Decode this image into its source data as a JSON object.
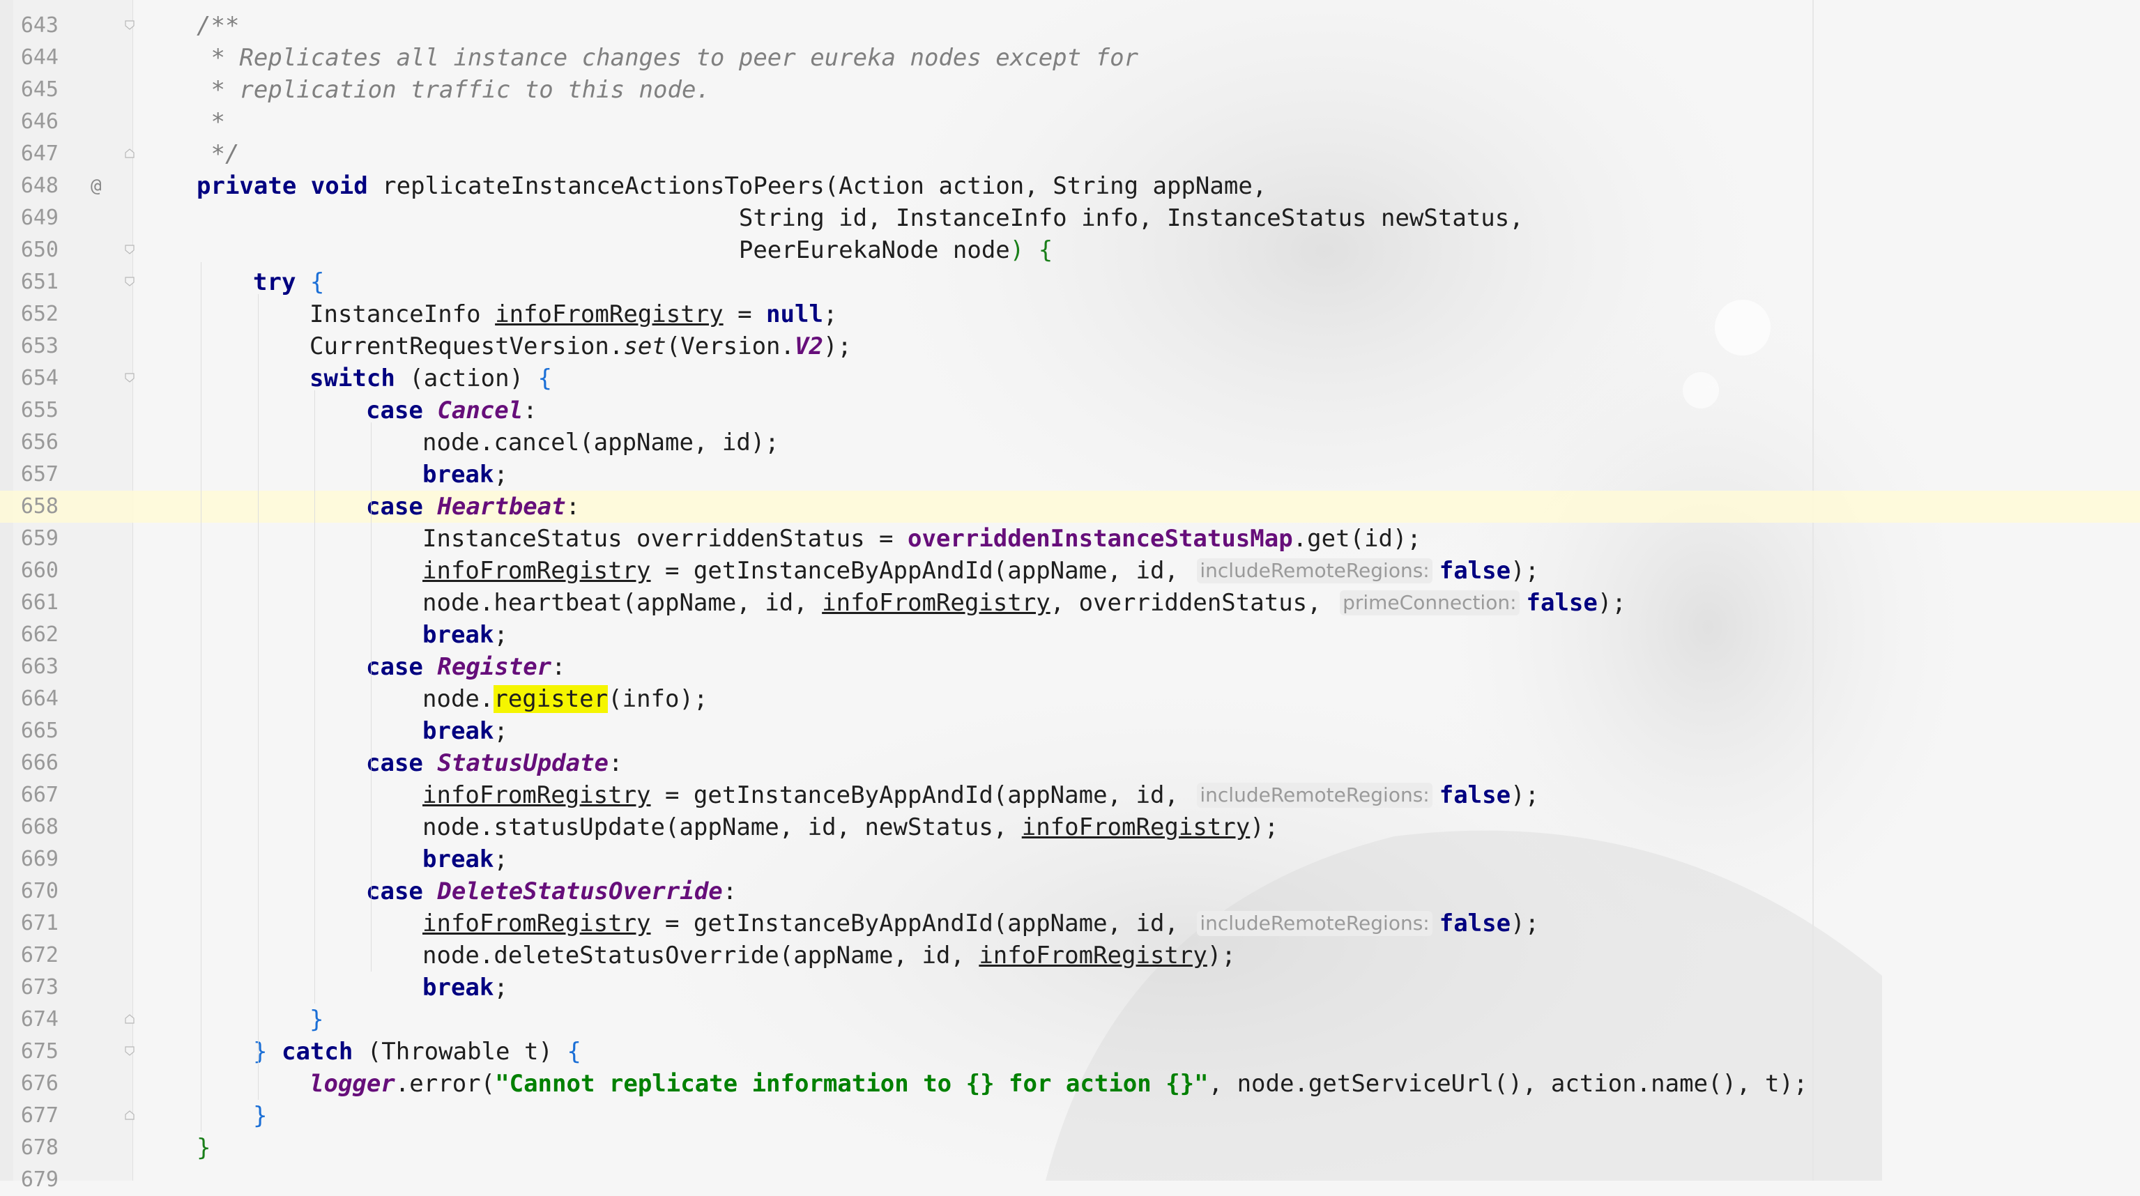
{
  "editor": {
    "lines": [
      {
        "num": "643",
        "gutter_icon": "",
        "fold": "start",
        "indent": 0,
        "tokens": [
          [
            "cm",
            "/**"
          ]
        ]
      },
      {
        "num": "644",
        "gutter_icon": "",
        "fold": "",
        "indent": 0,
        "tokens": [
          [
            "cm",
            " * Replicates all instance changes to peer eureka nodes except for"
          ]
        ]
      },
      {
        "num": "645",
        "gutter_icon": "",
        "fold": "",
        "indent": 0,
        "tokens": [
          [
            "cm",
            " * replication traffic to this node."
          ]
        ]
      },
      {
        "num": "646",
        "gutter_icon": "",
        "fold": "",
        "indent": 0,
        "tokens": [
          [
            "cm",
            " *"
          ]
        ]
      },
      {
        "num": "647",
        "gutter_icon": "",
        "fold": "end",
        "indent": 0,
        "tokens": [
          [
            "cm",
            " */"
          ]
        ]
      },
      {
        "num": "648",
        "gutter_icon": "@",
        "fold": "",
        "indent": 0,
        "tokens": [
          [
            "kw",
            "private"
          ],
          [
            "t",
            " "
          ],
          [
            "kw",
            "void"
          ],
          [
            "t",
            " replicateInstanceActionsToPeers(Action action, String appName,"
          ]
        ]
      },
      {
        "num": "649",
        "gutter_icon": "",
        "fold": "",
        "indent": 0,
        "tokens": [
          [
            "t",
            "                                      String id, InstanceInfo info, InstanceStatus newStatus,"
          ]
        ]
      },
      {
        "num": "650",
        "gutter_icon": "",
        "fold": "start",
        "indent": 0,
        "tokens": [
          [
            "t",
            "                                      PeerEurekaNode node"
          ],
          [
            "brg",
            ")"
          ],
          [
            "t",
            " "
          ],
          [
            "brg",
            "{"
          ]
        ]
      },
      {
        "num": "651",
        "gutter_icon": "",
        "fold": "start",
        "indent": 1,
        "tokens": [
          [
            "kw",
            "try"
          ],
          [
            "t",
            " "
          ],
          [
            "br",
            "{"
          ]
        ]
      },
      {
        "num": "652",
        "gutter_icon": "",
        "fold": "",
        "indent": 2,
        "tokens": [
          [
            "t",
            "InstanceInfo "
          ],
          [
            "ul",
            "infoFromRegistry"
          ],
          [
            "t",
            " = "
          ],
          [
            "kw",
            "null"
          ],
          [
            "t",
            ";"
          ]
        ]
      },
      {
        "num": "653",
        "gutter_icon": "",
        "fold": "",
        "indent": 2,
        "tokens": [
          [
            "t",
            "CurrentRequestVersion."
          ],
          [
            "st",
            "set"
          ],
          [
            "t",
            "(Version."
          ],
          [
            "en",
            "V2"
          ],
          [
            "t",
            ");"
          ]
        ]
      },
      {
        "num": "654",
        "gutter_icon": "",
        "fold": "start",
        "indent": 2,
        "tokens": [
          [
            "kw",
            "switch"
          ],
          [
            "t",
            " (action) "
          ],
          [
            "br",
            "{"
          ]
        ]
      },
      {
        "num": "655",
        "gutter_icon": "",
        "fold": "",
        "indent": 3,
        "tokens": [
          [
            "kw",
            "case"
          ],
          [
            "t",
            " "
          ],
          [
            "en",
            "Cancel"
          ],
          [
            "t",
            ":"
          ]
        ]
      },
      {
        "num": "656",
        "gutter_icon": "",
        "fold": "",
        "indent": 4,
        "tokens": [
          [
            "t",
            "node.cancel(appName, id);"
          ]
        ]
      },
      {
        "num": "657",
        "gutter_icon": "",
        "fold": "",
        "indent": 4,
        "tokens": [
          [
            "kw",
            "break"
          ],
          [
            "t",
            ";"
          ]
        ]
      },
      {
        "num": "658",
        "gutter_icon": "",
        "fold": "",
        "indent": 3,
        "highlight": true,
        "tokens": [
          [
            "kw",
            "case"
          ],
          [
            "t",
            " "
          ],
          [
            "en",
            "Heartbeat"
          ],
          [
            "t",
            ":"
          ]
        ]
      },
      {
        "num": "659",
        "gutter_icon": "",
        "fold": "",
        "indent": 4,
        "tokens": [
          [
            "t",
            "InstanceStatus overriddenStatus = "
          ],
          [
            "fld",
            "overriddenInstanceStatusMap"
          ],
          [
            "t",
            ".get(id);"
          ]
        ]
      },
      {
        "num": "660",
        "gutter_icon": "",
        "fold": "",
        "indent": 4,
        "tokens": [
          [
            "ul",
            "infoFromRegistry"
          ],
          [
            "t",
            " = getInstanceByAppAndId(appName, id, "
          ],
          [
            "hint",
            "includeRemoteRegions:"
          ],
          [
            "kw",
            "false"
          ],
          [
            "t",
            ");"
          ]
        ]
      },
      {
        "num": "661",
        "gutter_icon": "",
        "fold": "",
        "indent": 4,
        "tokens": [
          [
            "t",
            "node.heartbeat(appName, id, "
          ],
          [
            "ul",
            "infoFromRegistry"
          ],
          [
            "t",
            ", overriddenStatus, "
          ],
          [
            "hint",
            "primeConnection:"
          ],
          [
            "kw",
            "false"
          ],
          [
            "t",
            ");"
          ]
        ]
      },
      {
        "num": "662",
        "gutter_icon": "",
        "fold": "",
        "indent": 4,
        "tokens": [
          [
            "kw",
            "break"
          ],
          [
            "t",
            ";"
          ]
        ]
      },
      {
        "num": "663",
        "gutter_icon": "",
        "fold": "",
        "indent": 3,
        "tokens": [
          [
            "kw",
            "case"
          ],
          [
            "t",
            " "
          ],
          [
            "en",
            "Register"
          ],
          [
            "t",
            ":"
          ]
        ]
      },
      {
        "num": "664",
        "gutter_icon": "",
        "fold": "",
        "indent": 4,
        "tokens": [
          [
            "t",
            "node."
          ],
          [
            "mark",
            "register"
          ],
          [
            "t",
            "(info);"
          ]
        ]
      },
      {
        "num": "665",
        "gutter_icon": "",
        "fold": "",
        "indent": 4,
        "tokens": [
          [
            "kw",
            "break"
          ],
          [
            "t",
            ";"
          ]
        ]
      },
      {
        "num": "666",
        "gutter_icon": "",
        "fold": "",
        "indent": 3,
        "tokens": [
          [
            "kw",
            "case"
          ],
          [
            "t",
            " "
          ],
          [
            "en",
            "StatusUpdate"
          ],
          [
            "t",
            ":"
          ]
        ]
      },
      {
        "num": "667",
        "gutter_icon": "",
        "fold": "",
        "indent": 4,
        "tokens": [
          [
            "ul",
            "infoFromRegistry"
          ],
          [
            "t",
            " = getInstanceByAppAndId(appName, id, "
          ],
          [
            "hint",
            "includeRemoteRegions:"
          ],
          [
            "kw",
            "false"
          ],
          [
            "t",
            ");"
          ]
        ]
      },
      {
        "num": "668",
        "gutter_icon": "",
        "fold": "",
        "indent": 4,
        "tokens": [
          [
            "t",
            "node.statusUpdate(appName, id, newStatus, "
          ],
          [
            "ul",
            "infoFromRegistry"
          ],
          [
            "t",
            ");"
          ]
        ]
      },
      {
        "num": "669",
        "gutter_icon": "",
        "fold": "",
        "indent": 4,
        "tokens": [
          [
            "kw",
            "break"
          ],
          [
            "t",
            ";"
          ]
        ]
      },
      {
        "num": "670",
        "gutter_icon": "",
        "fold": "",
        "indent": 3,
        "tokens": [
          [
            "kw",
            "case"
          ],
          [
            "t",
            " "
          ],
          [
            "en",
            "DeleteStatusOverride"
          ],
          [
            "t",
            ":"
          ]
        ]
      },
      {
        "num": "671",
        "gutter_icon": "",
        "fold": "",
        "indent": 4,
        "tokens": [
          [
            "ul",
            "infoFromRegistry"
          ],
          [
            "t",
            " = getInstanceByAppAndId(appName, id, "
          ],
          [
            "hint",
            "includeRemoteRegions:"
          ],
          [
            "kw",
            "false"
          ],
          [
            "t",
            ");"
          ]
        ]
      },
      {
        "num": "672",
        "gutter_icon": "",
        "fold": "",
        "indent": 4,
        "tokens": [
          [
            "t",
            "node.deleteStatusOverride(appName, id, "
          ],
          [
            "ul",
            "infoFromRegistry"
          ],
          [
            "t",
            ");"
          ]
        ]
      },
      {
        "num": "673",
        "gutter_icon": "",
        "fold": "",
        "indent": 4,
        "tokens": [
          [
            "kw",
            "break"
          ],
          [
            "t",
            ";"
          ]
        ]
      },
      {
        "num": "674",
        "gutter_icon": "",
        "fold": "end",
        "indent": 2,
        "tokens": [
          [
            "br",
            "}"
          ]
        ]
      },
      {
        "num": "675",
        "gutter_icon": "",
        "fold": "start",
        "indent": 1,
        "tokens": [
          [
            "br",
            "}"
          ],
          [
            "t",
            " "
          ],
          [
            "kw",
            "catch"
          ],
          [
            "t",
            " (Throwable t) "
          ],
          [
            "br",
            "{"
          ]
        ]
      },
      {
        "num": "676",
        "gutter_icon": "",
        "fold": "",
        "indent": 2,
        "tokens": [
          [
            "fldi",
            "logger"
          ],
          [
            "t",
            ".error("
          ],
          [
            "str",
            "\"Cannot replicate information to {} for action {}\""
          ],
          [
            "t",
            ", node.getServiceUrl(), action.name(), t);"
          ]
        ]
      },
      {
        "num": "677",
        "gutter_icon": "",
        "fold": "end",
        "indent": 1,
        "tokens": [
          [
            "br",
            "}"
          ]
        ]
      },
      {
        "num": "678",
        "gutter_icon": "",
        "fold": "",
        "indent": 0,
        "tokens": [
          [
            "brg",
            "}"
          ]
        ]
      },
      {
        "num": "679",
        "gutter_icon": "",
        "fold": "",
        "indent": 0,
        "tokens": []
      }
    ]
  }
}
